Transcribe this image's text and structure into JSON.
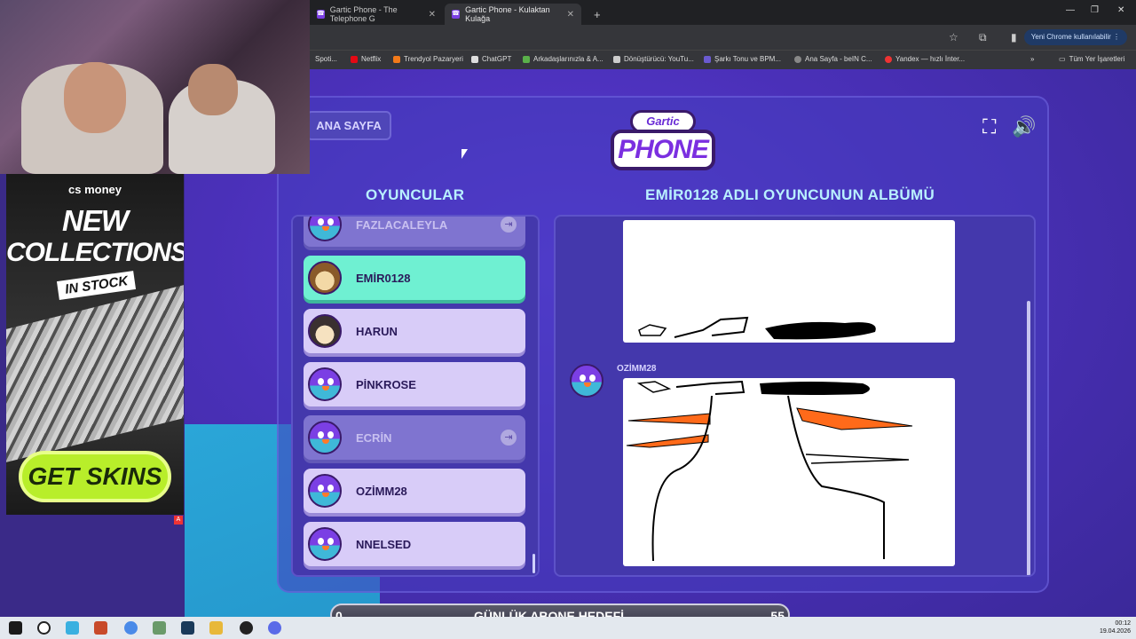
{
  "browser": {
    "tabs": [
      {
        "title": "Gartic Phone - The Telephone G"
      },
      {
        "title": "Gartic Phone - Kulaktan Kulağa"
      }
    ],
    "new_tab": "+",
    "user_button": "Yeni Chrome kullanılabilir",
    "bookmarks": [
      "Spoti...",
      "Netflix",
      "Trendyol Pazaryeri",
      "ChatGPT",
      "Arkadaşlarınızla & A...",
      "Dönüştürücü: YouTu...",
      "Şarkı Tonu ve BPM...",
      "Ana Sayfa - beIN C...",
      "Yandex — hızlı İnter..."
    ],
    "bookmarks_all": "Tüm Yer İşaretleri"
  },
  "game": {
    "home_button": "ANA SAYFA",
    "logo_top": "Gartic",
    "logo_main": "PHONE",
    "players_title": "OYUNCULAR",
    "album_title": "EMİR0128 ADLI OYUNCUNUN ALBÜMÜ",
    "players": [
      {
        "name": "FAZLACALEYLA",
        "state": "dim"
      },
      {
        "name": "EMİR0128",
        "state": "active"
      },
      {
        "name": "HARUN",
        "state": "normal"
      },
      {
        "name": "PİNKROSE",
        "state": "normal"
      },
      {
        "name": "ECRİN",
        "state": "dim"
      },
      {
        "name": "OZİMM28",
        "state": "normal"
      },
      {
        "name": "NNELSED",
        "state": "normal"
      }
    ],
    "album_author": "OZİMM28"
  },
  "goal": {
    "left": "0",
    "label": "GÜNLÜK ABONE HEDEFİ",
    "right": "55"
  },
  "ad": {
    "brand": "cs money",
    "line1": "NEW",
    "line2": "COLLECTIONS",
    "stock": "IN STOCK",
    "cta": "GET SKINS",
    "badge": "A"
  },
  "taskbar": {
    "time": "00:12",
    "date": "19.04.2026"
  },
  "colors": {
    "accent_active": "#6ff0d2",
    "title_cyan": "#b9f0ff",
    "drawing_orange": "#ff6a1a"
  }
}
